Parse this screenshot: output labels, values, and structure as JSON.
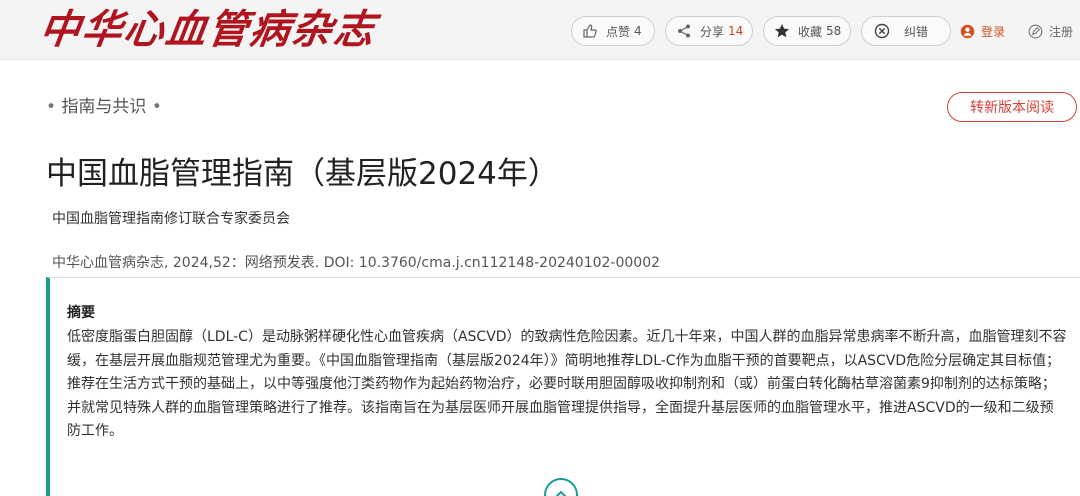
{
  "header": {
    "logo_text": "中华心血管病杂志",
    "like": {
      "label": "点赞",
      "count": "4",
      "icon": "thumbs-up-icon"
    },
    "share": {
      "label": "分享",
      "count": "14",
      "icon": "share-icon"
    },
    "favorite": {
      "label": "收藏",
      "count": "58",
      "icon": "star-icon"
    },
    "correct": {
      "label": "纠错",
      "icon": "close-circle-icon"
    },
    "login": {
      "label": "登录",
      "icon": "user-icon"
    },
    "register": {
      "label": "注册",
      "icon": "pencil-icon"
    }
  },
  "article": {
    "section": "指南与共识",
    "new_version_label": "转新版本阅读",
    "title": "中国血脂管理指南（基层版2024年）",
    "authors": "中国血脂管理指南修订联合专家委员会",
    "citation": "中华心血管病杂志, 2024,52：网络预发表. DOI: 10.3760/cma.j.cn112148-20240102-00002",
    "abstract_heading": "摘要",
    "abstract_text": "低密度脂蛋白胆固醇（LDL-C）是动脉粥样硬化性心血管疾病（ASCVD）的致病性危险因素。近几十年来，中国人群的血脂异常患病率不断升高，血脂管理刻不容缓，在基层开展血脂规范管理尤为重要。《中国血脂管理指南（基层版2024年）》简明地推荐LDL-C作为血脂干预的首要靶点，以ASCVD危险分层确定其目标值；推荐在生活方式干预的基础上，以中等强度他汀类药物作为起始药物治疗，必要时联用胆固醇吸收抑制剂和（或）前蛋白转化酶枯草溶菌素9抑制剂的达标策略；并就常见特殊人群的血脂管理策略进行了推荐。该指南旨在为基层医师开展血脂管理提供指导，全面提升基层医师的血脂管理水平，推进ASCVD的一级和二级预防工作。"
  },
  "colors": {
    "brand_red": "#b0141e",
    "accent_teal": "#1f9a93",
    "button_red": "#d8403a",
    "share_count": "#c8471c"
  }
}
